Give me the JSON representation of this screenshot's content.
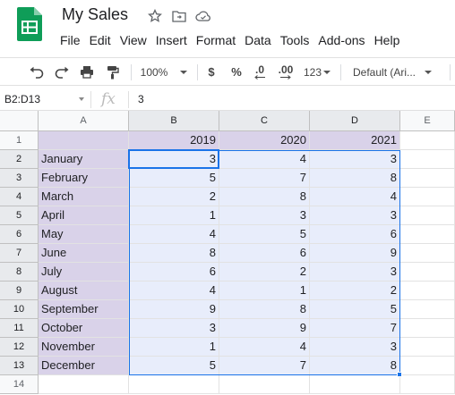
{
  "app": {
    "title": "My Sales",
    "menu": [
      "File",
      "Edit",
      "View",
      "Insert",
      "Format",
      "Data",
      "Tools",
      "Add-ons",
      "Help"
    ]
  },
  "toolbar": {
    "zoom": "100%",
    "currency": "$",
    "percent": "%",
    "decrease_decimal": ".0",
    "increase_decimal": ".00",
    "more_formats": "123",
    "font": "Default (Ari..."
  },
  "formula_bar": {
    "name_box": "B2:D13",
    "fx": "fx",
    "value": "3"
  },
  "sheet": {
    "columns": [
      "A",
      "B",
      "C",
      "D",
      "E"
    ],
    "rows": [
      "1",
      "2",
      "3",
      "4",
      "5",
      "6",
      "7",
      "8",
      "9",
      "10",
      "11",
      "12",
      "13",
      "14"
    ],
    "header_row": [
      "",
      "2019",
      "2020",
      "2021"
    ],
    "data": [
      [
        "January",
        "3",
        "4",
        "3"
      ],
      [
        "February",
        "5",
        "7",
        "8"
      ],
      [
        "March",
        "2",
        "8",
        "4"
      ],
      [
        "April",
        "1",
        "3",
        "3"
      ],
      [
        "May",
        "4",
        "5",
        "6"
      ],
      [
        "June",
        "8",
        "6",
        "9"
      ],
      [
        "July",
        "6",
        "2",
        "3"
      ],
      [
        "August",
        "4",
        "1",
        "2"
      ],
      [
        "September",
        "9",
        "8",
        "5"
      ],
      [
        "October",
        "3",
        "9",
        "7"
      ],
      [
        "November",
        "1",
        "4",
        "3"
      ],
      [
        "December",
        "5",
        "7",
        "8"
      ]
    ]
  },
  "colors": {
    "accent": "#1a73e8",
    "label_fill": "#d9d2e9",
    "selection_fill": "#e8edfb",
    "logo_green": "#0f9d58"
  }
}
